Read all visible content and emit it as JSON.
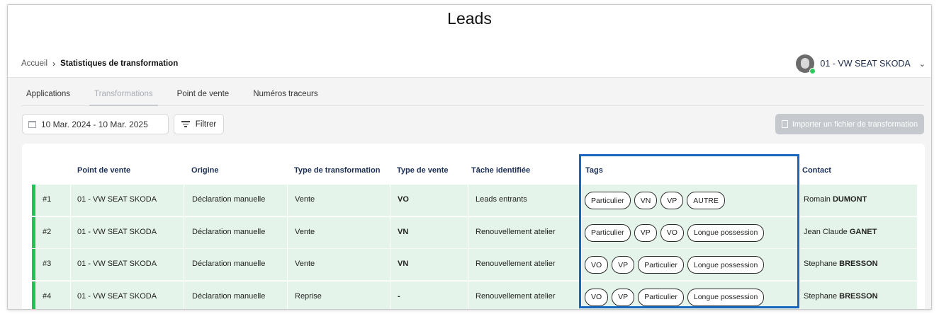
{
  "header": {
    "title": "Leads"
  },
  "breadcrumb": {
    "home": "Accueil",
    "separator": "›",
    "current": "Statistiques de transformation"
  },
  "account": {
    "name": "01 - VW SEAT SKODA",
    "status_color": "#2ecc5e"
  },
  "tabs": [
    {
      "label": "Applications",
      "active": false
    },
    {
      "label": "Transformations",
      "active": true
    },
    {
      "label": "Point de vente",
      "active": false
    },
    {
      "label": "Numéros traceurs",
      "active": false
    }
  ],
  "toolbar": {
    "date_range": "10 Mar. 2024  - 10 Mar. 2025",
    "filter_label": "Filtrer",
    "import_label": "Importer un fichier de transformation"
  },
  "table": {
    "columns": [
      "Point de vente",
      "Origine",
      "Type de transformation",
      "Type de vente",
      "Tâche identifiée",
      "Tags",
      "Contact"
    ],
    "rows": [
      {
        "index": "#1",
        "point_de_vente": "01 - VW SEAT SKODA",
        "origine": "Déclaration manuelle",
        "type_transformation": "Vente",
        "type_vente": "VO",
        "tache": "Leads entrants",
        "tags": [
          "Particulier",
          "VN",
          "VP",
          "AUTRE"
        ],
        "contact_first": "Romain",
        "contact_last": "DUMONT"
      },
      {
        "index": "#2",
        "point_de_vente": "01 - VW SEAT SKODA",
        "origine": "Déclaration manuelle",
        "type_transformation": "Vente",
        "type_vente": "VN",
        "tache": "Renouvellement atelier",
        "tags": [
          "Particulier",
          "VP",
          "VO",
          "Longue possession"
        ],
        "contact_first": "Jean Claude",
        "contact_last": "GANET"
      },
      {
        "index": "#3",
        "point_de_vente": "01 - VW SEAT SKODA",
        "origine": "Déclaration manuelle",
        "type_transformation": "Vente",
        "type_vente": "VN",
        "tache": "Renouvellement atelier",
        "tags": [
          "VO",
          "VP",
          "Particulier",
          "Longue possession"
        ],
        "contact_first": "Stephane",
        "contact_last": "BRESSON"
      },
      {
        "index": "#4",
        "point_de_vente": "01 - VW SEAT SKODA",
        "origine": "Déclaration manuelle",
        "type_transformation": "Reprise",
        "type_vente": "-",
        "tache": "Renouvellement atelier",
        "tags": [
          "VO",
          "VP",
          "Particulier",
          "Longue possession"
        ],
        "contact_first": "Stephane",
        "contact_last": "BRESSON"
      }
    ]
  },
  "colors": {
    "row_bg": "#e4f4ea",
    "row_accent": "#24c05a",
    "highlight": "#1767be",
    "import_button": "#c5c8cd"
  }
}
